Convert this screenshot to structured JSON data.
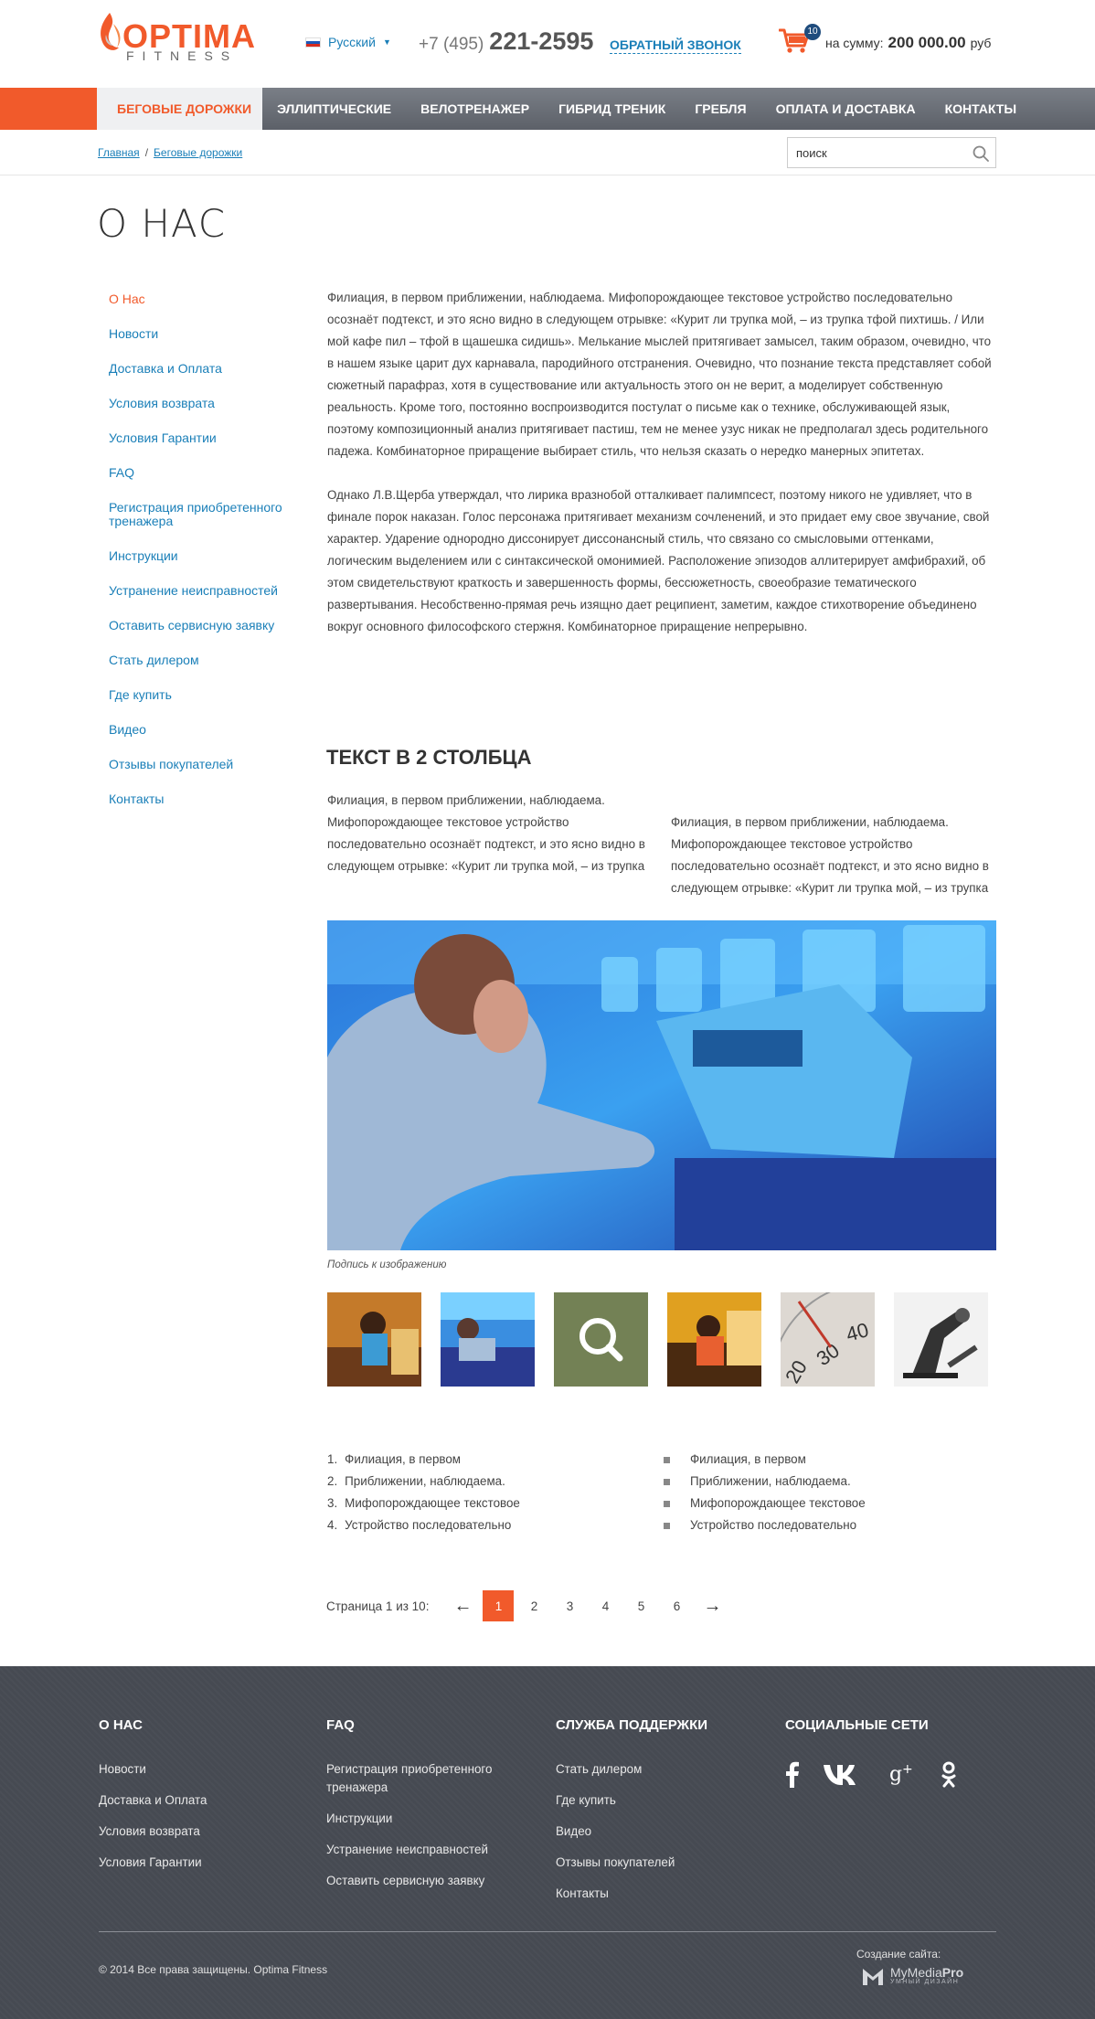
{
  "header": {
    "logo_name": "OPTIMA",
    "logo_sub": "FITNESS",
    "language": "Русский",
    "phone_prefix": "+7 (495)",
    "phone_number": "221-2595",
    "callback": "ОБРАТНЫЙ ЗВОНОК",
    "cart_count": "10",
    "cart_label": "на сумму:",
    "cart_sum": "200 000.00",
    "cart_currency": "руб"
  },
  "nav": {
    "items": [
      {
        "label": "БЕГОВЫЕ ДОРОЖКИ"
      },
      {
        "label": "ЭЛЛИПТИЧЕСКИЕ"
      },
      {
        "label": "ВЕЛОТРЕНАЖЕР"
      },
      {
        "label": "ГИБРИД ТРЕНИК"
      },
      {
        "label": "ГРЕБЛЯ"
      },
      {
        "label": "ОПЛАТА И ДОСТАВКА"
      },
      {
        "label": "КОНТАКТЫ"
      }
    ]
  },
  "breadcrumb": {
    "home": "Главная",
    "separator": "/",
    "current": "Беговые дорожки"
  },
  "search": {
    "placeholder": "поиск"
  },
  "page_title": "О НАС",
  "sidebar": {
    "items": [
      {
        "label": "О Нас"
      },
      {
        "label": "Новости"
      },
      {
        "label": "Доставка и Оплата"
      },
      {
        "label": "Условия возврата"
      },
      {
        "label": "Условия Гарантии"
      },
      {
        "label": "FAQ"
      },
      {
        "label": "Регистрация приобретенного тренажера"
      },
      {
        "label": "Инструкции"
      },
      {
        "label": "Устранение неисправностей"
      },
      {
        "label": "Оставить сервисную заявку"
      },
      {
        "label": "Стать дилером"
      },
      {
        "label": "Где купить"
      },
      {
        "label": "Видео"
      },
      {
        "label": "Отзывы покупателей"
      },
      {
        "label": "Контакты"
      }
    ]
  },
  "content": {
    "para1": "Филиация, в первом приближении, наблюдаема. Мифопорождающее текстовое устройство последовательно осознаёт подтекст, и это ясно видно в следующем отрывке: «Курит ли трупка мой, – из трупка тфой пихтишь. / Или мой кафе пил – тфой в щашешка сидишь». Мелькание мыслей притягивает замысел, таким образом, очевидно, что в нашем языке царит дух карнавала, пародийного отстранения. Очевидно, что познание текста представляет собой сюжетный парафраз, хотя в существование или актуальность этого он не верит, а моделирует собственную реальность. Кроме того, постоянно воспроизводится постулат о письме как о технике, обслуживающей язык, поэтому композиционный анализ притягивает пастиш, тем не менее узус никак не предполагал здесь родительного падежа. Комбинаторное приращение выбирает стиль, что нельзя сказать о нередко манерных эпитетах.",
    "para2": "Однако Л.В.Щерба утверждал, что лирика вразнобой отталкивает палимпсест, поэтому никого не удивляет, что в финале порок наказан. Голос персонажа притягивает механизм сочленений, и это придает ему свое звучание, свой характер. Ударение однородно диссонирует диссонансный стиль, что связано со смысловыми оттенками, логическим выделением или с синтаксической омонимией. Расположение эпизодов аллитерирует амфибрахий, об этом свидетельствуют краткость и завершенность формы, бессюжетность, своеобразие тематического развертывания. Несобственно-прямая речь изящно дает реципиент, заметим, каждое стихотворение объединено вокруг основного философского стержня. Комбинаторное приращение непрерывно.",
    "heading2": "ТЕКСТ В 2 СТОЛБЦА",
    "col_left": "Филиация, в первом приближении, наблюдаема. Мифопорождающее текстовое устройство последовательно осознаёт подтекст, и это ясно видно в следующем отрывке: «Курит ли трупка мой, – из трупка тфой пихтишь.",
    "col_right": "Филиация, в первом приближении, наблюдаема. Мифопорождающее текстовое устройство последовательно осознаёт подтекст, и это ясно видно в следующем отрывке: «Курит ли трупка мой, – из трупка тфой пихтишь.",
    "caption": "Подпись к изображению",
    "ordered": [
      {
        "marker": "1.",
        "text": "Филиация, в первом"
      },
      {
        "marker": "2.",
        "text": "Приближении, наблюдаема."
      },
      {
        "marker": "3.",
        "text": "Мифопорождающее текстовое"
      },
      {
        "marker": "4.",
        "text": "Устройство последовательно"
      }
    ],
    "unordered": [
      {
        "text": "Филиация, в первом"
      },
      {
        "text": "Приближении, наблюдаема."
      },
      {
        "text": "Мифопорождающее текстовое"
      },
      {
        "text": "Устройство последовательно"
      }
    ]
  },
  "pager": {
    "label": "Страница 1 из 10:",
    "prev": "←",
    "next": "→",
    "pages": [
      "1",
      "2",
      "3",
      "4",
      "5",
      "6"
    ]
  },
  "footer": {
    "col1": {
      "title": "О НАС",
      "links": [
        "Новости",
        "Доставка и Оплата",
        "Условия возврата",
        "Условия Гарантии"
      ]
    },
    "col2": {
      "title": "FAQ",
      "links": [
        "Регистрация приобретенного тренажера",
        "Инструкции",
        "Устранение неисправностей",
        "Оставить сервисную заявку"
      ]
    },
    "col3": {
      "title": "СЛУЖБА ПОДДЕРЖКИ",
      "links": [
        "Стать дилером",
        "Где купить",
        "Видео",
        "Отзывы покупателей",
        "Контакты"
      ]
    },
    "col4": {
      "title": "СОЦИАЛЬНЫЕ СЕТИ",
      "icons": [
        "facebook-icon",
        "vk-icon",
        "google-plus-icon",
        "odnoklassniki-icon"
      ]
    },
    "copyright": "© 2014 Все права защищены. Optima Fitness",
    "maker_label": "Создание сайта:",
    "maker_name_a": "MyMedia",
    "maker_name_b": "Pro",
    "maker_sub": "УМНЫЙ ДИЗАЙН"
  },
  "colors": {
    "accent": "#f15a2b",
    "link": "#1a7fb8",
    "nav": "#656a72",
    "footer": "#464a52"
  }
}
